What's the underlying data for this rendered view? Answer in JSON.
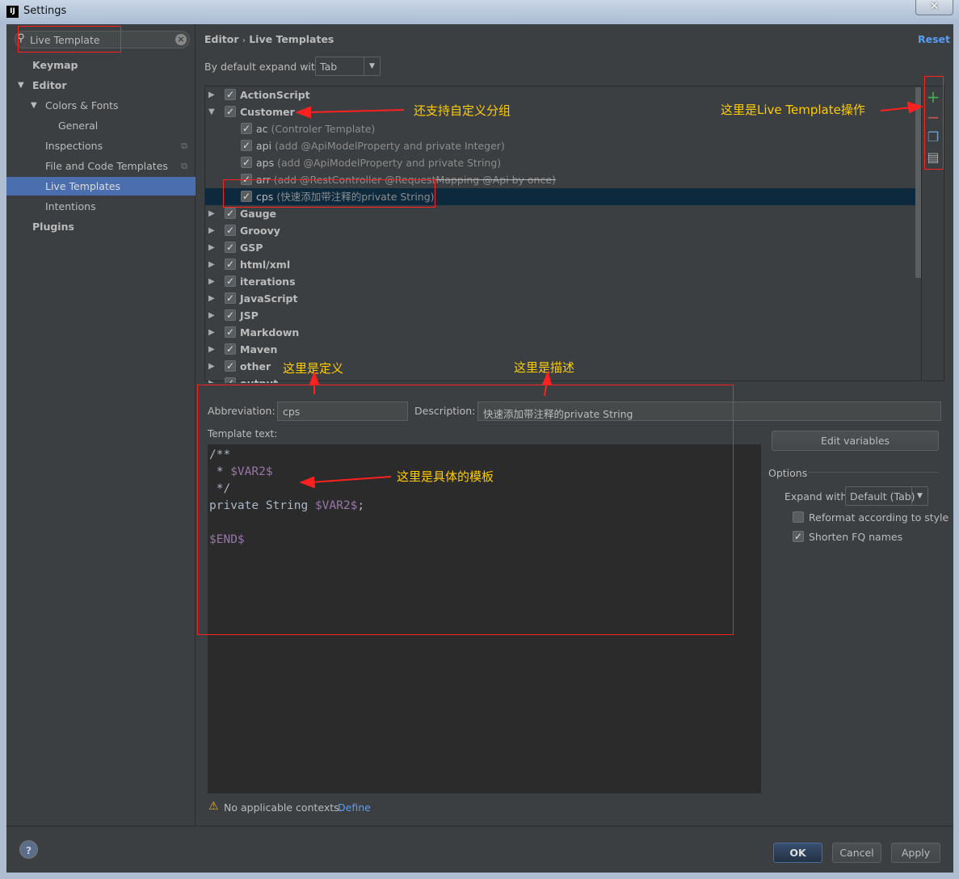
{
  "window": {
    "title": "Settings",
    "app_icon": "IJ",
    "close": "✕"
  },
  "search": {
    "value": "Live Template"
  },
  "sidebar": {
    "items": [
      {
        "label": "Keymap"
      },
      {
        "label": "Editor"
      },
      {
        "label": "Colors & Fonts"
      },
      {
        "label": "General"
      },
      {
        "label": "Inspections"
      },
      {
        "label": "File and Code Templates"
      },
      {
        "label": "Live Templates"
      },
      {
        "label": "Intentions"
      },
      {
        "label": "Plugins"
      }
    ]
  },
  "header": {
    "crumb1": "Editor",
    "sep": "›",
    "crumb2": "Live Templates",
    "reset": "Reset"
  },
  "expand": {
    "label": "By default expand with",
    "value": "Tab"
  },
  "tree": {
    "groups_top": [
      {
        "name": "ActionScript"
      },
      {
        "name": "Customer"
      }
    ],
    "templates": [
      {
        "abbr": "ac",
        "desc": "(Controler Template)"
      },
      {
        "abbr": "api",
        "desc": "(add @ApiModelProperty and private Integer)"
      },
      {
        "abbr": "aps",
        "desc": "(add @ApiModelProperty and private String)"
      },
      {
        "abbr": "arr",
        "desc": "(add @RestController @RequestMapping @Api by once)"
      },
      {
        "abbr": "cps",
        "desc": "(快速添加带注释的private String)"
      }
    ],
    "groups": [
      {
        "name": "Gauge"
      },
      {
        "name": "Groovy"
      },
      {
        "name": "GSP"
      },
      {
        "name": "html/xml"
      },
      {
        "name": "iterations"
      },
      {
        "name": "JavaScript"
      },
      {
        "name": "JSP"
      },
      {
        "name": "Markdown"
      },
      {
        "name": "Maven"
      },
      {
        "name": "other"
      },
      {
        "name": "output"
      }
    ]
  },
  "toolbar": {
    "add": "+",
    "remove": "−"
  },
  "form": {
    "abbr_label": "Abbreviation:",
    "abbr_value": "cps",
    "desc_label": "Description:",
    "desc_value": "快速添加带注释的private String",
    "template_label": "Template text:",
    "template_lines": [
      "/**",
      " * ",
      "$VAR2$",
      " */",
      "private String ",
      "$VAR2$",
      ";",
      "$END$"
    ]
  },
  "options": {
    "edit_variables": "Edit variables",
    "title": "Options",
    "expand_label": "Expand with",
    "expand_value": "Default (Tab)",
    "reformat": "Reformat according to style",
    "reformat_checked": false,
    "shorten": "Shorten FQ names",
    "shorten_checked": true
  },
  "warning": {
    "text": "No applicable contexts.",
    "link": "Define"
  },
  "buttons": {
    "ok": "OK",
    "cancel": "Cancel",
    "apply": "Apply",
    "help": "?"
  },
  "annotations": {
    "custom_group": "还支持自定义分组",
    "operations": "这里是Live Template操作",
    "definition": "这里是定义",
    "description": "这里是描述",
    "template": "这里是具体的模板"
  },
  "colors": {
    "accent": "#4b6eaf",
    "link": "#589df6",
    "variable": "#9876aa",
    "annotation": "#ffcc00",
    "add": "#3fae4a",
    "remove": "#c75450"
  }
}
